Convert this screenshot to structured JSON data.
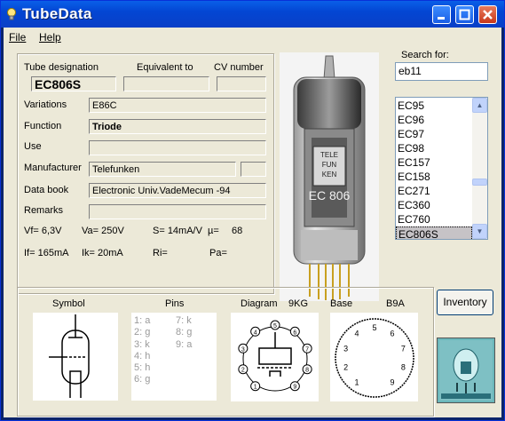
{
  "window": {
    "title": "TubeData"
  },
  "menu": {
    "file": "File",
    "help": "Help"
  },
  "fields": {
    "tube_designation_label": "Tube designation",
    "equivalent_label": "Equivalent to",
    "cv_label": "CV number",
    "tube_designation": "EC806S",
    "equivalent": "",
    "cv_number": "",
    "variations_label": "Variations",
    "variations": "E86C",
    "function_label": "Function",
    "function": "Triode",
    "use_label": "Use",
    "use": "",
    "manufacturer_label": "Manufacturer",
    "manufacturer": "Telefunken",
    "manufacturer_extra": "",
    "databook_label": "Data book",
    "databook": "Electronic Univ.VadeMecum -94",
    "remarks_label": "Remarks",
    "remarks": ""
  },
  "specs": {
    "vf": "Vf= 6,3V",
    "va": "Va= 250V",
    "s": "S= 14mA/V",
    "mu_label": "µ=",
    "mu": "68",
    "if": "If= 165mA",
    "ik": "Ik= 20mA",
    "ri": "Ri=",
    "pa": "Pa="
  },
  "search": {
    "label": "Search for:",
    "value": "eb11"
  },
  "tube_list": {
    "items": [
      "EC95",
      "EC96",
      "EC97",
      "EC98",
      "EC157",
      "EC158",
      "EC271",
      "EC360",
      "EC760",
      "EC806S"
    ],
    "selected": "EC806S"
  },
  "photo": {
    "tube_print_1": "TELE",
    "tube_print_2": "FUN",
    "tube_print_3": "KEN",
    "tube_print_4": "EC 806"
  },
  "bottom": {
    "symbol_label": "Symbol",
    "pins_label": "Pins",
    "diagram_label": "Diagram",
    "diagram_code": "9KG",
    "base_label": "Base",
    "base_code": "B9A",
    "pins_col1": [
      "1: a",
      "2: g",
      "3: k",
      "4: h",
      "5: h",
      "6: g"
    ],
    "pins_col2": [
      "7: k",
      "8: g",
      "9: a"
    ],
    "diagram_pins": [
      "1",
      "2",
      "3",
      "4",
      "5",
      "6",
      "7",
      "8",
      "9"
    ],
    "base_pins": [
      "1",
      "2",
      "3",
      "4",
      "5",
      "6",
      "7",
      "8",
      "9"
    ]
  },
  "buttons": {
    "inventory": "Inventory"
  },
  "colors": {
    "titlebar": "#0346d3",
    "face": "#ece9d8",
    "selected": "#c6c3c6"
  }
}
